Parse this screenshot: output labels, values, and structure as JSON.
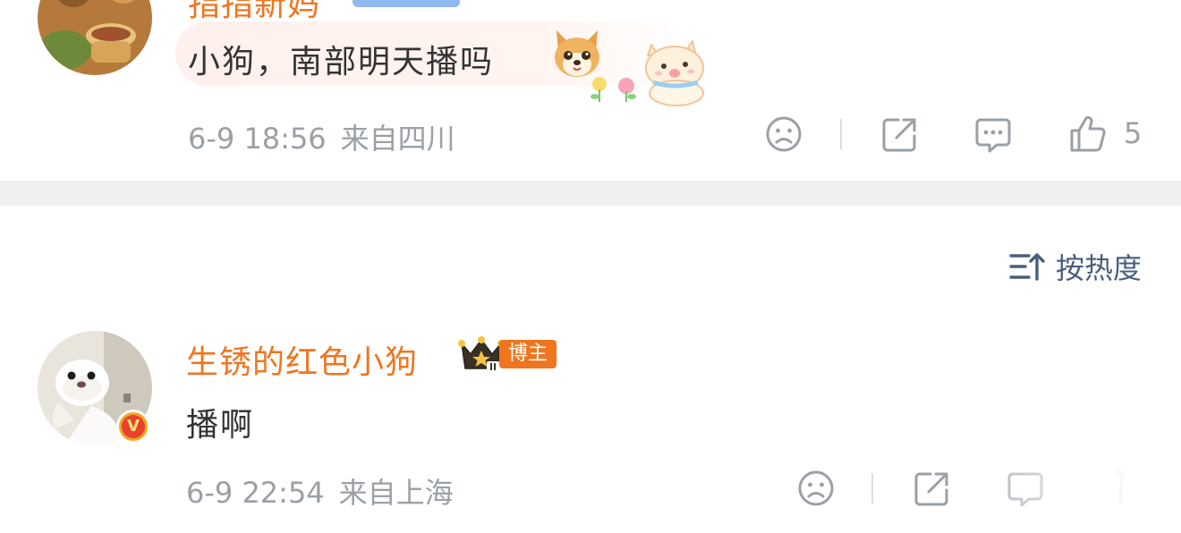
{
  "comment1": {
    "username": "指指新妈",
    "text": "小狗，南部明天播吗",
    "time": "6-9 18:56",
    "location": "来自四川",
    "like_count": "5"
  },
  "sort": {
    "label": "按热度"
  },
  "comment2": {
    "username": "生锈的红色小狗",
    "badge": "博主",
    "vip_glyph": "V",
    "text": "播啊",
    "time": "6-9 22:54",
    "location": "来自上海"
  },
  "colors": {
    "username": "#f0751f",
    "meta": "#9aa0a6",
    "sort_link": "#4a5f7d",
    "divider_band": "#f0f0f0"
  },
  "icons": [
    "sad-face-icon",
    "share-icon",
    "comment-icon",
    "thumbs-up-icon",
    "sort-icon",
    "crown-icon",
    "vip-badge-icon"
  ]
}
